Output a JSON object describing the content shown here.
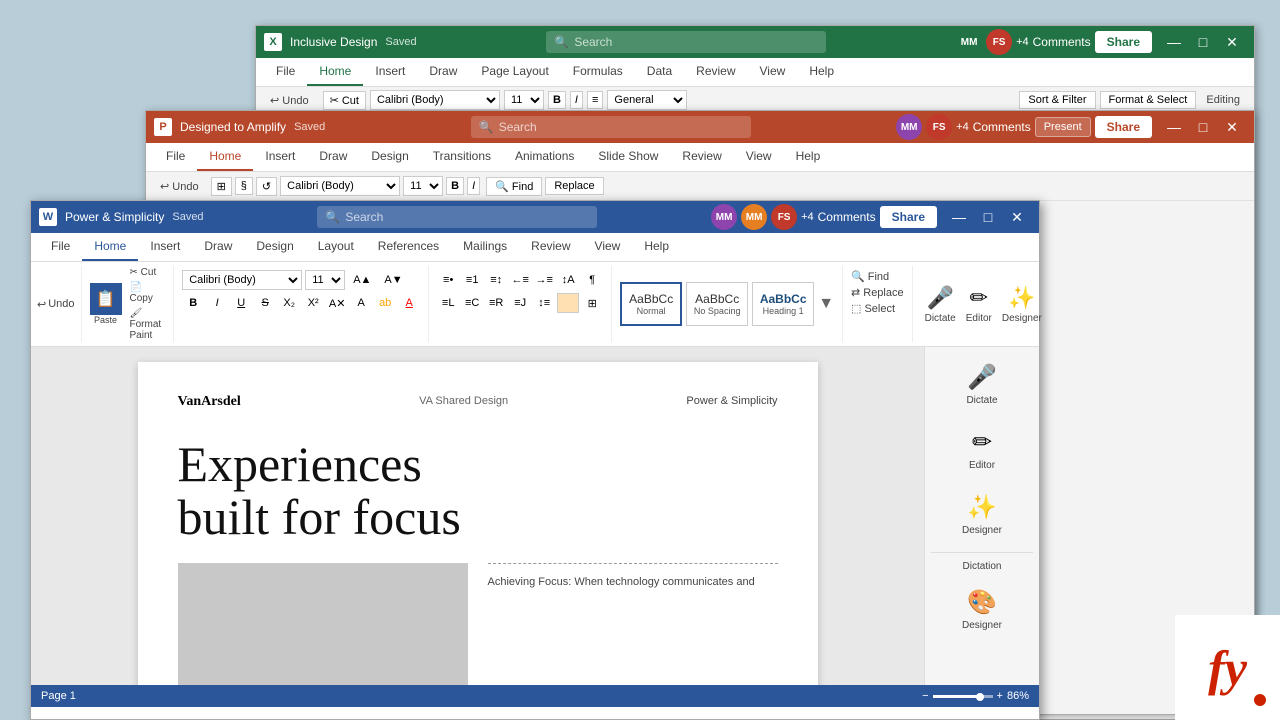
{
  "desktop": {
    "background": "#b8cdd8"
  },
  "window_back": {
    "title": "Inclusive Design",
    "saved": "Saved",
    "app": "Excel",
    "search_placeholder": "Search",
    "tabs": [
      "File",
      "Home",
      "Insert",
      "Draw",
      "Page Layout",
      "Formulas",
      "Data",
      "Review",
      "View",
      "Help"
    ],
    "active_tab": "Home",
    "user_count": "+4",
    "share_label": "Share",
    "comments_label": "Comments"
  },
  "window_mid": {
    "title": "Designed to Amplify",
    "saved": "Saved",
    "app": "PowerPoint",
    "search_placeholder": "Search",
    "tabs": [
      "File",
      "Home",
      "Insert",
      "Draw",
      "Design",
      "Transitions",
      "Animations",
      "Slide Show",
      "Review",
      "View",
      "Help"
    ],
    "active_tab": "Home",
    "user_count": "+4",
    "present_label": "Present",
    "share_label": "Share",
    "comments_label": "Comments"
  },
  "window_front": {
    "title": "Power & Simplicity",
    "saved": "Saved",
    "app": "Word",
    "search_placeholder": "Search",
    "tabs": [
      "File",
      "Home",
      "Insert",
      "Draw",
      "Design",
      "Layout",
      "References",
      "Mailings",
      "Review",
      "View",
      "Help"
    ],
    "active_tab": "Home",
    "user_count": "+4",
    "share_label": "Share",
    "comments_label": "Comments",
    "undo_label": "Undo",
    "font_name": "Calibri (Body)",
    "font_size": "11",
    "styles": [
      {
        "name": "Normal",
        "label": "Normal",
        "preview": "AaBbCc"
      },
      {
        "name": "No Spacing",
        "label": "No Spacing",
        "preview": "AaBbCc"
      },
      {
        "name": "Heading 1",
        "label": "Heading 1",
        "preview": "AaBbCc"
      }
    ],
    "editing": {
      "find_label": "Find",
      "replace_label": "Replace",
      "select_label": "Select"
    },
    "dictation": {
      "dictate_label": "Dictate",
      "editor_label": "Editor",
      "designer_label": "Designer"
    }
  },
  "document": {
    "logo": "VanArsdel",
    "subtitle": "VA Shared Design",
    "title_right": "Power & Simplicity",
    "headline_line1": "Experiences",
    "headline_line2": "built for focus",
    "body_text": "Achieving Focus: When technology communicates and",
    "image_placeholder": "image",
    "vertical_text": "VA Shared Design"
  },
  "status_bar": {
    "page_info": "Page 1",
    "zoom": "86%"
  },
  "right_panel": {
    "dictate_label": "Dictate",
    "editor_label": "Editor",
    "designer_label": "Designer",
    "dictation_label": "Dictation",
    "designer2_label": "Designer"
  },
  "red_logo": {
    "text": "fy"
  }
}
